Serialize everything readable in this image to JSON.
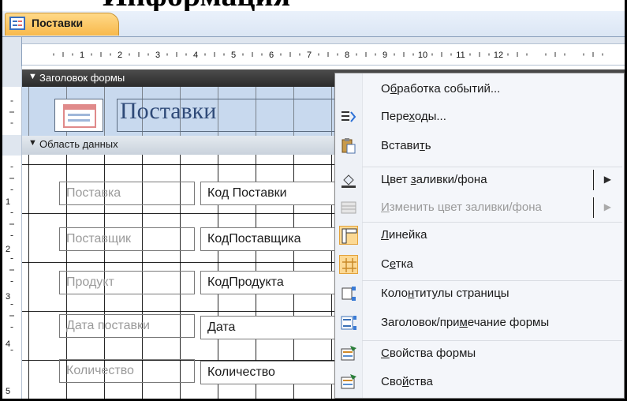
{
  "document_tab": {
    "label": "Поставки"
  },
  "ruler": {
    "ticks": [
      "1",
      "2",
      "3",
      "4",
      "5",
      "6",
      "7",
      "8",
      "9",
      "10",
      "11",
      "12"
    ]
  },
  "vruler": {
    "ticks": [
      "1",
      "2",
      "3",
      "4",
      "5"
    ]
  },
  "form_header": {
    "band_label": "Заголовок формы",
    "title": "Поставки"
  },
  "data_area": {
    "band_label": "Область данных",
    "rows": [
      {
        "label": "Поставка",
        "field": "Код Поставки"
      },
      {
        "label": "Поставщик",
        "field": "КодПоставщика"
      },
      {
        "label": "Продукт",
        "field": "КодПродукта"
      },
      {
        "label": "Дата поставки",
        "field": "Дата"
      },
      {
        "label": "Количество",
        "field": "Количество"
      }
    ]
  },
  "context_menu": {
    "items": [
      {
        "pre": "О",
        "u": "б",
        "post": "работка событий...",
        "icon": "none",
        "enabled": true
      },
      {
        "pre": "Пере",
        "u": "х",
        "post": "оды...",
        "icon": "transitions-icon",
        "enabled": true
      },
      {
        "pre": "Встави",
        "u": "т",
        "post": "ь",
        "icon": "paste-icon",
        "enabled": true
      },
      {
        "pre": "Цвет ",
        "u": "з",
        "post": "аливки/фона",
        "icon": "fill-color-icon",
        "enabled": true,
        "submenu": true
      },
      {
        "pre": "",
        "u": "И",
        "post": "зменить цвет заливки/фона",
        "icon": "alt-fill-icon",
        "enabled": false,
        "submenu": true
      },
      {
        "pre": "",
        "u": "Л",
        "post": "инейка",
        "icon": "ruler-icon",
        "enabled": true,
        "checked": true
      },
      {
        "pre": "С",
        "u": "е",
        "post": "тка",
        "icon": "grid-icon",
        "enabled": true,
        "checked": true
      },
      {
        "pre": "Коло",
        "u": "н",
        "post": "титулы страницы",
        "icon": "page-header-footer-icon",
        "enabled": true
      },
      {
        "pre": "Заголовок/при",
        "u": "м",
        "post": "ечание формы",
        "icon": "form-header-footer-icon",
        "enabled": true
      },
      {
        "pre": "",
        "u": "С",
        "post": "войства формы",
        "icon": "form-properties-icon",
        "enabled": true
      },
      {
        "pre": "Сво",
        "u": "й",
        "post": "ства",
        "icon": "properties-icon",
        "enabled": true
      }
    ]
  },
  "colors": {
    "menu_check_bg": "#fcd994",
    "section_band": "#3a3a3a",
    "header_bg": "#c8d9ee",
    "tab_bg": "#f8b94c"
  }
}
